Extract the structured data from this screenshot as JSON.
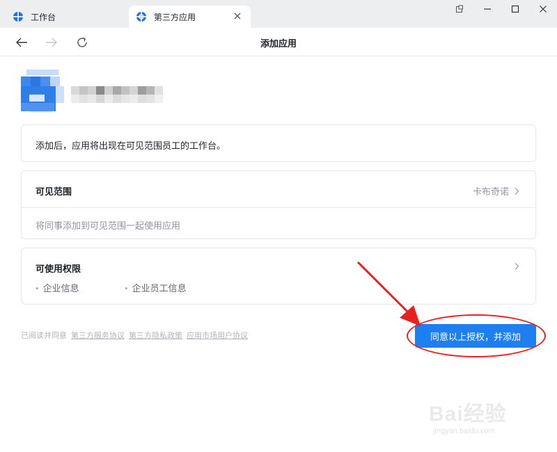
{
  "tabs": [
    {
      "label": "工作台",
      "icon": "crosshair-icon"
    },
    {
      "label": "第三方应用",
      "icon": "crosshair-icon"
    }
  ],
  "nav": {
    "title": "添加应用"
  },
  "notice": "添加后，应用将出现在可见范围员工的工作台。",
  "scope": {
    "title": "可见范围",
    "value": "卡布奇诺",
    "hint": "将同事添加到可见范围一起使用应用"
  },
  "permissions": {
    "title": "可使用权限",
    "items": [
      "企业信息",
      "企业员工信息"
    ]
  },
  "agreement": {
    "prefix": "已阅读并同意",
    "links": [
      "第三方服务协议",
      "第三方隐私政策",
      "应用市场用户协议"
    ]
  },
  "primary_button": "同意以上授权，并添加",
  "watermark": {
    "brand": "Bai经验",
    "url": "jingyan.baidu.com"
  },
  "colors": {
    "accent": "#1e7ff0",
    "annotation": "#e8201f"
  }
}
